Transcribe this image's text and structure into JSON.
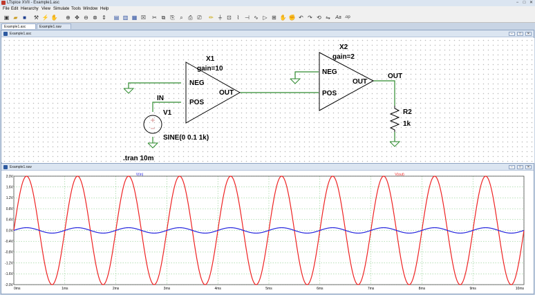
{
  "app": {
    "title": "LTspice XVII - Example1.asc",
    "minimize": "−",
    "maximize": "□",
    "close": "✕"
  },
  "menu": [
    "File",
    "Edit",
    "Hierarchy",
    "View",
    "Simulate",
    "Tools",
    "Window",
    "Help"
  ],
  "toolbar_icons": [
    "new-schematic-icon",
    "open-icon",
    "save-icon",
    "control-panel-icon",
    "run-icon",
    "halt-icon",
    "zoom-in-icon",
    "pan-icon",
    "zoom-out-icon",
    "zoom-fit-icon",
    "autorange-icon",
    "tile-horizontal-icon",
    "cascade-icon",
    "tile-vertical-icon",
    "close-icon",
    "print-icon",
    "print-preview-icon",
    "find-icon",
    "wire-icon",
    "ground-icon",
    "label-net-icon",
    "resistor-icon",
    "capacitor-icon",
    "inductor-icon",
    "diode-icon",
    "component-icon",
    "move-icon",
    "drag-icon",
    "undo-icon",
    "redo-icon",
    "rotate-icon",
    "mirror-icon",
    "text-icon",
    "spice-directive-icon",
    "delete-icon",
    "duplicate-icon",
    "cut-icon",
    "copy-icon",
    "paste-icon"
  ],
  "toolbar_text": {
    "text_tool": "Aa",
    "spice_tool": ".op"
  },
  "tabs": [
    "Example1.asc",
    "Example1.raw"
  ],
  "schematic": {
    "window_title": "Example1.asc",
    "x1_name": "X1",
    "x1_gain": "gain=10",
    "x1_neg": "NEG",
    "x1_pos": "POS",
    "x1_out": "OUT",
    "x2_name": "X2",
    "x2_gain": "gain=2",
    "x2_neg": "NEG",
    "x2_pos": "POS",
    "x2_out": "OUT",
    "in_label": "IN",
    "out_label": "OUT",
    "v1_name": "V1",
    "v1_value": "SINE(0 0.1 1k)",
    "r2_name": "R2",
    "r2_value": "1k",
    "directive": ".tran 10m"
  },
  "plot": {
    "window_title": "Example1.raw",
    "trace_in_label": "V(in)",
    "trace_out_label": "V(out)"
  },
  "colors": {
    "trace_in": "#2222dd",
    "trace_out": "#ee2222",
    "wire": "#2e8b2e",
    "grid": "#70c070",
    "component": "#000000"
  },
  "chart_data": {
    "type": "line",
    "title": "",
    "xlabel": "",
    "ylabel": "",
    "x_ticks": [
      "0ms",
      "1ms",
      "2ms",
      "3ms",
      "4ms",
      "5ms",
      "6ms",
      "7ms",
      "8ms",
      "9ms",
      "10ms"
    ],
    "y_ticks": [
      "2.0V",
      "1.6V",
      "1.2V",
      "0.8V",
      "0.4V",
      "0.0V",
      "-0.4V",
      "-0.8V",
      "-1.2V",
      "-1.6V",
      "-2.0V"
    ],
    "xlim": [
      0,
      10
    ],
    "ylim": [
      -2.0,
      2.0
    ],
    "grid": true,
    "series": [
      {
        "name": "V(in)",
        "waveform": "sine",
        "amplitude": 0.1,
        "frequency_khz": 1,
        "phase_deg": 0
      },
      {
        "name": "V(out)",
        "waveform": "sine",
        "amplitude": 2.0,
        "frequency_khz": 1,
        "phase_deg": 0
      }
    ]
  }
}
